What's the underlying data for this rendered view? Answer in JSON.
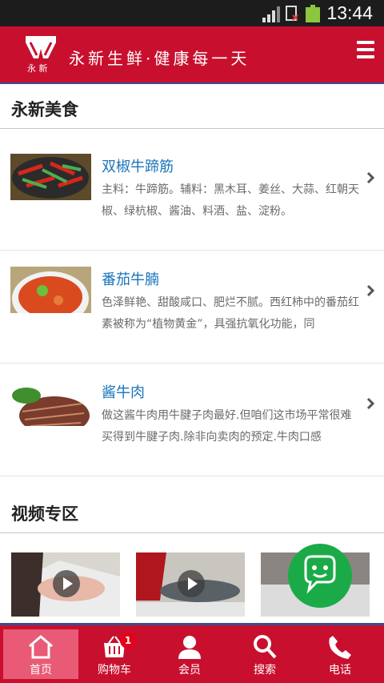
{
  "status_bar": {
    "time": "13:44"
  },
  "header": {
    "brand_small": "永 新",
    "slogan": "永新生鲜·健康每一天"
  },
  "section_food": {
    "title": "永新美食",
    "items": [
      {
        "name": "双椒牛蹄筋",
        "desc": "主料：牛蹄筋。辅料：黑木耳、姜丝、大蒜、红朝天椒、绿杭椒、酱油、料酒、盐、淀粉。"
      },
      {
        "name": "番茄牛腩",
        "desc": "色泽鲜艳、甜酸咸口、肥烂不腻。西红柿中的番茄红素被称为“植物黄金”，具强抗氧化功能，同"
      },
      {
        "name": "酱牛肉",
        "desc": "做这酱牛肉用牛腱子肉最好.但咱们这市场平常很难买得到牛腱子肉.除非向卖肉的预定.牛肉口感"
      }
    ]
  },
  "section_video": {
    "title": "视频专区"
  },
  "bottom_nav": {
    "items": [
      {
        "label": "首页",
        "icon": "home-icon"
      },
      {
        "label": "购物车",
        "icon": "cart-icon",
        "badge": "1"
      },
      {
        "label": "会员",
        "icon": "user-icon"
      },
      {
        "label": "搜索",
        "icon": "search-icon"
      },
      {
        "label": "电话",
        "icon": "phone-icon"
      }
    ]
  },
  "colors": {
    "primary": "#c8102e",
    "link": "#1b75bb",
    "wechat": "#1aab48",
    "nav_active": "#e85a75"
  }
}
